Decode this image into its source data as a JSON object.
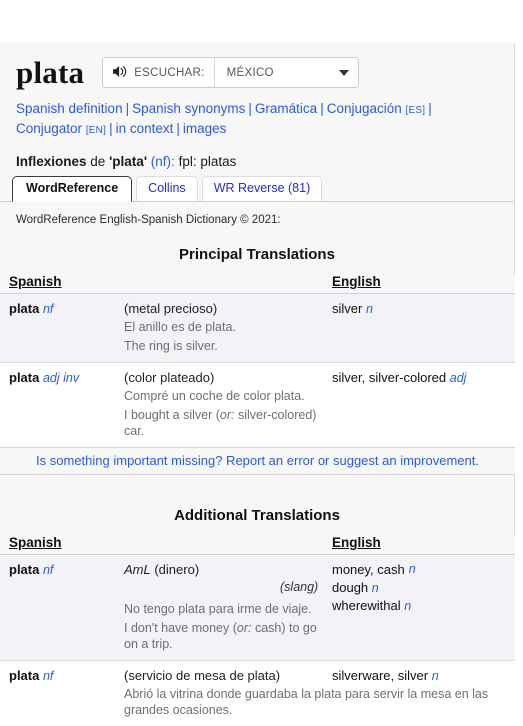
{
  "headword": "plata",
  "audio": {
    "icon": "speaker-icon",
    "listen_label": "ESCUCHAR:",
    "dialect_value": "MÉXICO",
    "caret_icon": "chevron-down-icon"
  },
  "links": {
    "separator": "|",
    "items": [
      {
        "label": "Spanish definition",
        "sub": ""
      },
      {
        "label": "Spanish synonyms",
        "sub": ""
      },
      {
        "label": "Gramática",
        "sub": ""
      },
      {
        "label": "Conjugación",
        "sub": "[ES]"
      },
      {
        "label": "Conjugator",
        "sub": "[EN]"
      },
      {
        "label": "in context",
        "sub": ""
      },
      {
        "label": "images",
        "sub": ""
      }
    ]
  },
  "inflections": {
    "title": "Inflexiones",
    "de": "de",
    "word": "'plata'",
    "pos": "(nf):",
    "forms": "fpl: platas"
  },
  "tabs": [
    {
      "label": "WordReference",
      "active": true
    },
    {
      "label": "Collins",
      "active": false
    },
    {
      "label": "WR Reverse (81)",
      "active": false
    }
  ],
  "credit": "WordReference English-Spanish Dictionary © 2021:",
  "sections": [
    {
      "title": "Principal Translations",
      "headers": {
        "spanish": "Spanish",
        "english": "English"
      },
      "report": "Is something important missing? Report an error or suggest an improvement.",
      "rows": [
        {
          "es_word": "plata",
          "es_pos": "nf",
          "sense": "(metal precioso)",
          "example_es": "El anillo es de plata.",
          "example_en": "The ring is silver.",
          "en_term": "silver",
          "en_pos": "n",
          "extras": []
        },
        {
          "es_word": "plata",
          "es_pos": "adj inv",
          "sense": "(color plateado)",
          "example_es": "Compré un coche de color plata.",
          "example_en_pre": "I bought a silver (",
          "example_en_or": "or:",
          "example_en_post": " silver-colored) car.",
          "en_term": "silver, silver-colored",
          "en_pos": "adj",
          "extras": []
        }
      ]
    },
    {
      "title": "Additional Translations",
      "headers": {
        "spanish": "Spanish",
        "english": "English"
      },
      "rows": [
        {
          "es_word": "plata",
          "es_pos": "nf",
          "sense_reg": "AmL",
          "sense": " (dinero)",
          "example_es": "No tengo plata para irme de viaje.",
          "example_en_pre": "I don't have money (",
          "example_en_or": "or:",
          "example_en_post": " cash) to go on a trip.",
          "en_term": "money, cash",
          "en_pos": "n",
          "extras": [
            {
              "tag": "(slang)",
              "term": "dough",
              "pos": "n"
            },
            {
              "tag": "",
              "term": "wherewithal",
              "pos": "n"
            }
          ]
        },
        {
          "es_word": "plata",
          "es_pos": "nf",
          "sense": "(servicio de mesa de plata)",
          "example_es": "Abrió la vitrina donde guardaba la plata para servir la mesa en las grandes ocasiones.",
          "en_term": "silverware, silver",
          "en_pos": "n",
          "extras": []
        }
      ]
    }
  ]
}
